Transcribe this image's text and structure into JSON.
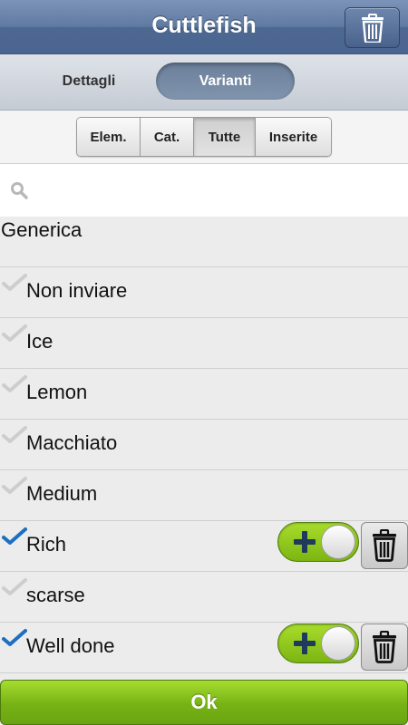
{
  "header": {
    "title": "Cuttlefish",
    "trash_icon": "trash-icon"
  },
  "tabs": [
    {
      "label": "Dettagli",
      "active": false
    },
    {
      "label": "Varianti",
      "active": true
    }
  ],
  "filters": {
    "options": [
      "Elem.",
      "Cat.",
      "Tutte",
      "Inserite"
    ],
    "selected": "Tutte"
  },
  "search": {
    "placeholder": "",
    "value": "",
    "icon": "search-icon"
  },
  "list": {
    "group_label": "Generica",
    "items": [
      {
        "label": "Non inviare",
        "checked": false,
        "has_controls": false
      },
      {
        "label": "Ice",
        "checked": false,
        "has_controls": false
      },
      {
        "label": "Lemon",
        "checked": false,
        "has_controls": false
      },
      {
        "label": "Macchiato",
        "checked": false,
        "has_controls": false
      },
      {
        "label": "Medium",
        "checked": false,
        "has_controls": false
      },
      {
        "label": "Rich",
        "checked": true,
        "has_controls": true,
        "toggle_icon": "plus-icon",
        "toggle_on": true
      },
      {
        "label": "scarse",
        "checked": false,
        "has_controls": false
      },
      {
        "label": "Well done",
        "checked": true,
        "has_controls": true,
        "toggle_icon": "plus-icon",
        "toggle_on": true
      }
    ]
  },
  "footer": {
    "ok_label": "Ok"
  },
  "colors": {
    "check_on": "#1d6fc2",
    "check_off": "#c9c9c9",
    "accent_green": "#8cc51e",
    "header_blue": "#5f7aa2"
  }
}
